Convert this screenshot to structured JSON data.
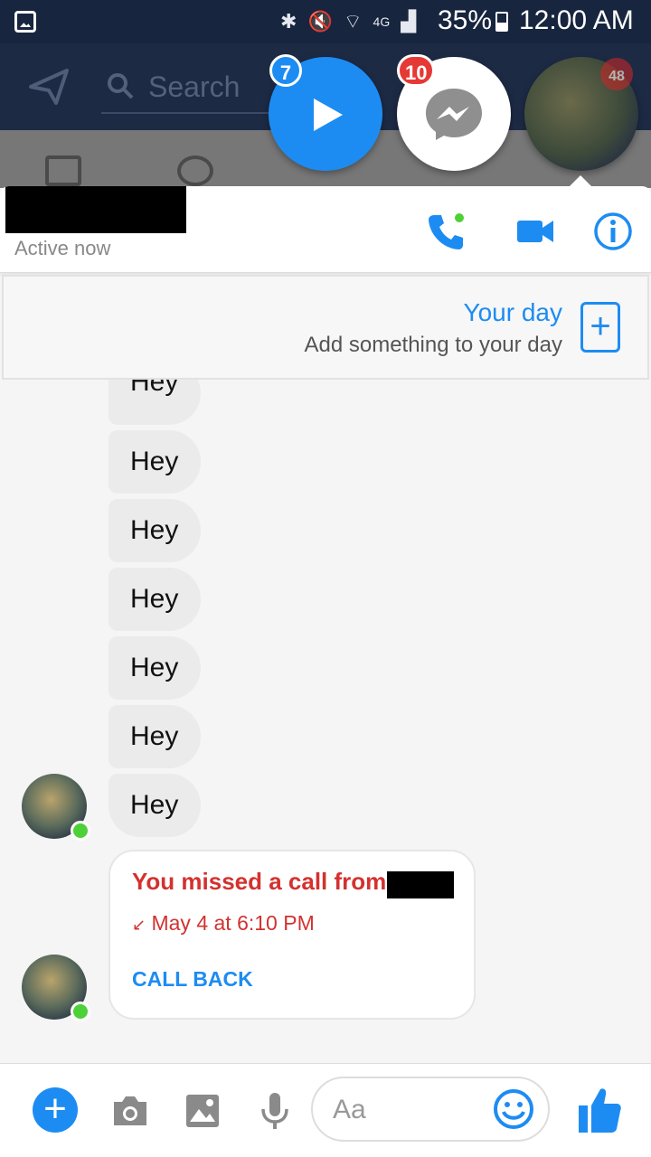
{
  "status_bar": {
    "battery": "35%",
    "time": "12:00 AM",
    "network": "4G"
  },
  "app_header": {
    "search_placeholder": "Search"
  },
  "chat_heads": {
    "play_badge": "7",
    "messenger_badge": "10",
    "avatar_badge": "48"
  },
  "conversation": {
    "status": "Active now"
  },
  "your_day": {
    "title": "Your day",
    "subtitle": "Add something to your day"
  },
  "messages": [
    "Hey",
    "Hey",
    "Hey",
    "Hey",
    "Hey",
    "Hey",
    "Hey"
  ],
  "missed_call": {
    "title": "You missed a call from",
    "time": "May 4 at 6:10 PM",
    "action": "CALL BACK"
  },
  "composer": {
    "placeholder": "Aa"
  },
  "colors": {
    "accent": "#1d8cf2",
    "missed": "#d3322f",
    "online": "#4cd137"
  }
}
